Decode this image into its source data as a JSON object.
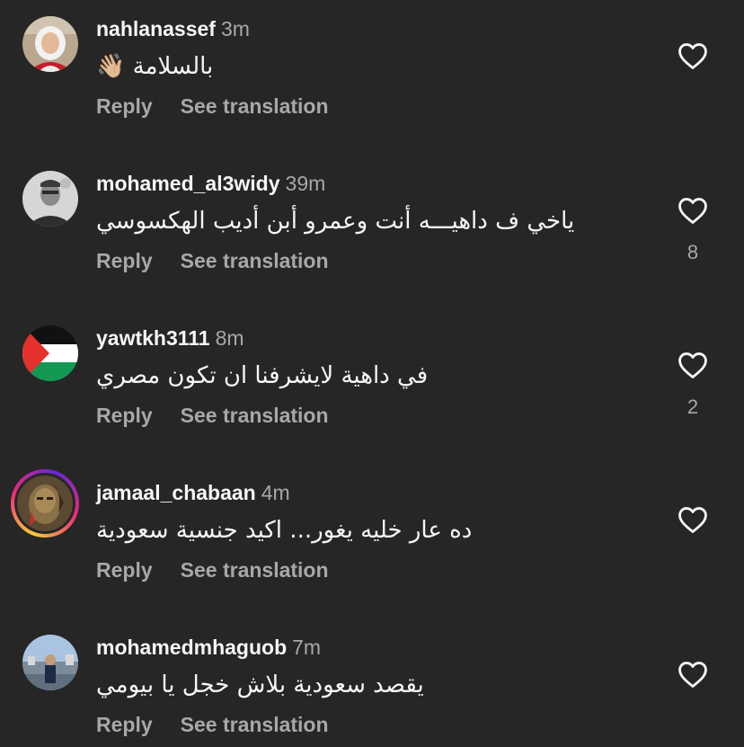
{
  "comments": [
    {
      "username": "nahlanassef",
      "time": "3m",
      "text": "بالسلامة 👋🏼",
      "reply_label": "Reply",
      "translate_label": "See translation",
      "likes": ""
    },
    {
      "username": "mohamed_al3widy",
      "time": "39m",
      "text": "ياخي ف داهيـــه أنت وعمرو أبن أديب الهكسوسي",
      "reply_label": "Reply",
      "translate_label": "See translation",
      "likes": "8"
    },
    {
      "username": "yawtkh3111",
      "time": "8m",
      "text": "في داهية لايشرفنا ان تكون مصري",
      "reply_label": "Reply",
      "translate_label": "See translation",
      "likes": "2"
    },
    {
      "username": "jamaal_chabaan",
      "time": "4m",
      "text": "ده عار خليه يغور... اكيد جنسية سعودية",
      "reply_label": "Reply",
      "translate_label": "See translation",
      "likes": ""
    },
    {
      "username": "mohamedmhaguob",
      "time": "7m",
      "text": "يقصد سعودية بلاش خجل يا بيومي",
      "reply_label": "Reply",
      "translate_label": "See translation",
      "likes": ""
    }
  ],
  "colors": {
    "background": "#262626",
    "primary_text": "#f5f5f5",
    "secondary_text": "#a8a8a8"
  },
  "icons": {
    "like": "heart-outline-icon"
  }
}
